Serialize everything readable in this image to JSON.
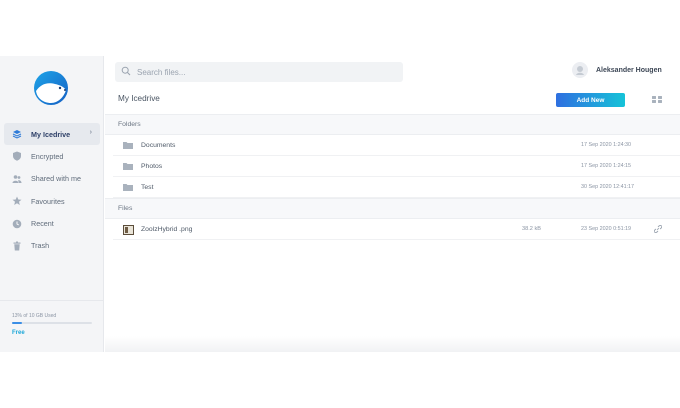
{
  "search": {
    "placeholder": "Search files..."
  },
  "user": {
    "name": "Aleksander Hougen"
  },
  "header": {
    "title": "My Icedrive",
    "add_new_label": "Add New"
  },
  "sidebar": {
    "items": [
      {
        "label": "My Icedrive",
        "icon": "layers-icon",
        "active": true
      },
      {
        "label": "Encrypted",
        "icon": "shield-icon",
        "active": false
      },
      {
        "label": "Shared with me",
        "icon": "users-icon",
        "active": false
      },
      {
        "label": "Favourites",
        "icon": "star-icon",
        "active": false
      },
      {
        "label": "Recent",
        "icon": "clock-icon",
        "active": false
      },
      {
        "label": "Trash",
        "icon": "trash-icon",
        "active": false
      }
    ],
    "storage": {
      "text": "13% of 10 GB Used",
      "used_percent": 13,
      "plan": "Free"
    }
  },
  "sections": {
    "folders_label": "Folders",
    "files_label": "Files"
  },
  "folders": [
    {
      "name": "Documents",
      "date": "17 Sep 2020 1:24:30"
    },
    {
      "name": "Photos",
      "date": "17 Sep 2020 1:24:15"
    },
    {
      "name": "Test",
      "date": "30 Sep 2020 12:41:17"
    }
  ],
  "files": [
    {
      "name": "ZoolzHybrid .png",
      "size": "38.2 kB",
      "date": "23 Sep 2020 0:51:19"
    }
  ],
  "colors": {
    "accent_start": "#2f6fe0",
    "accent_end": "#16c3d8",
    "plan": "#1ca7d8"
  }
}
